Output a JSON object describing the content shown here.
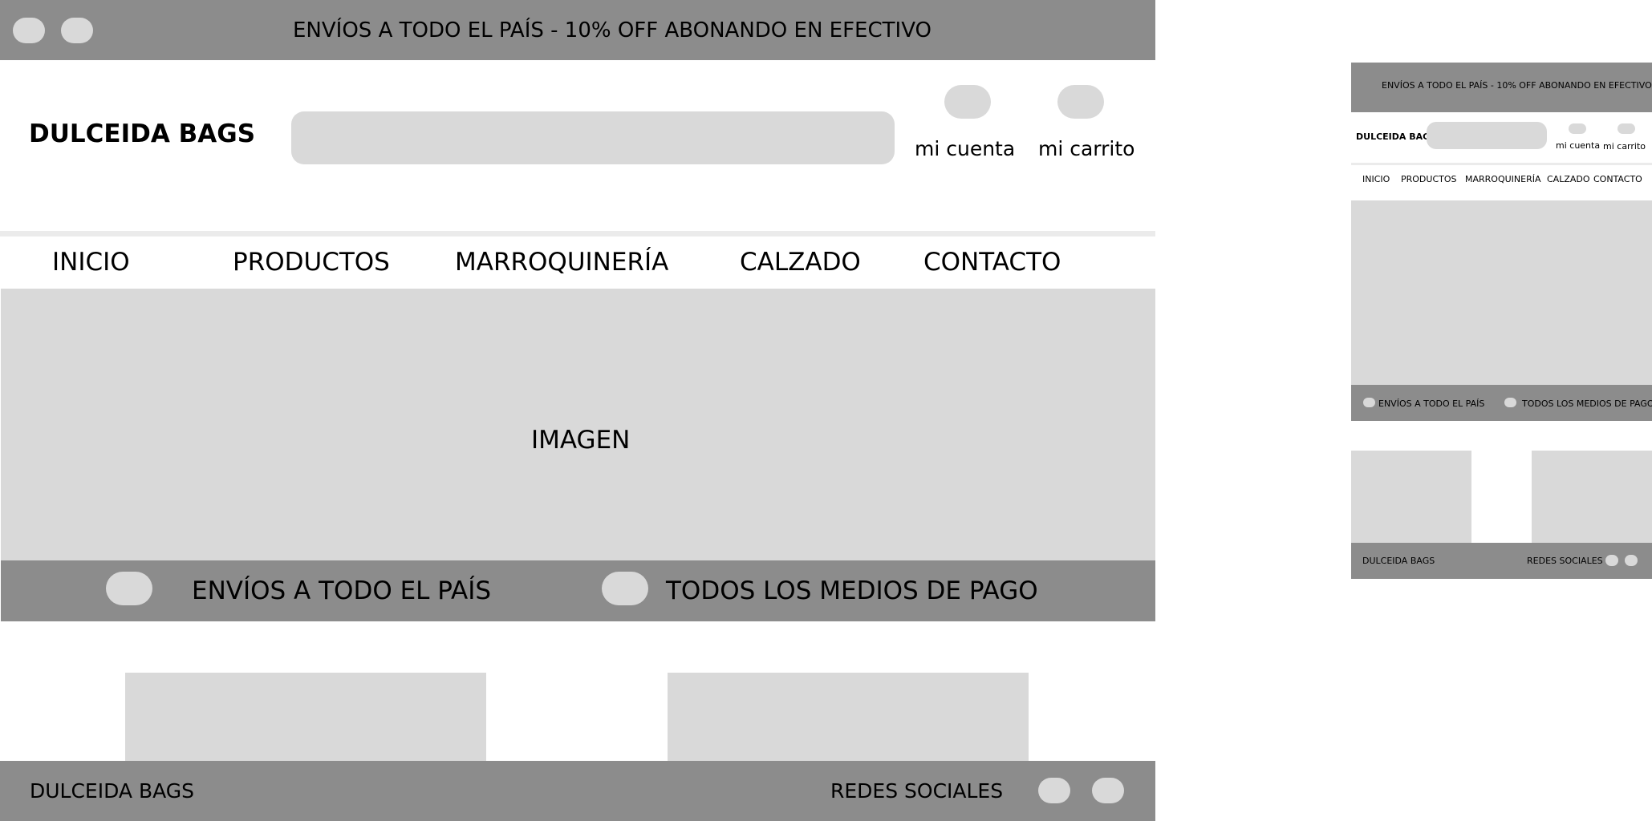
{
  "desktop": {
    "announcement": "ENVÍOS A TODO EL PAÍS - 10% OFF ABONANDO EN EFECTIVO",
    "header": {
      "logo": "DULCEIDA BAGS",
      "account_label": "mi cuenta",
      "cart_label": "mi carrito"
    },
    "nav": [
      "INICIO",
      "PRODUCTOS",
      "MARROQUINERÍA",
      "CALZADO",
      "CONTACTO"
    ],
    "hero_label": "IMAGEN",
    "benefits": [
      "ENVÍOS A TODO EL PAÍS",
      "TODOS LOS MEDIOS DE PAGO"
    ],
    "footer": {
      "brand": "DULCEIDA BAGS",
      "social_label": "REDES SOCIALES"
    }
  },
  "mobile": {
    "announcement": "ENVÍOS A TODO EL PAÍS - 10% OFF ABONANDO EN EFECTIVO",
    "header": {
      "logo": "DULCEIDA BAGS",
      "account_label": "mi cuenta",
      "cart_label": "mi carrito"
    },
    "nav": [
      "INICIO",
      "PRODUCTOS",
      "MARROQUINERÍA",
      "CALZADO",
      "CONTACTO"
    ],
    "benefits": [
      "ENVÍOS A TODO EL PAÍS",
      "TODOS LOS MEDIOS DE PAGO"
    ],
    "footer": {
      "brand": "DULCEIDA BAGS",
      "social_label": "REDES SOCIALES"
    }
  },
  "colors": {
    "bar_grey": "#8c8c8c",
    "placeholder_grey": "#d9d9d9",
    "divider": "#ebebeb",
    "background": "#ffffff"
  }
}
